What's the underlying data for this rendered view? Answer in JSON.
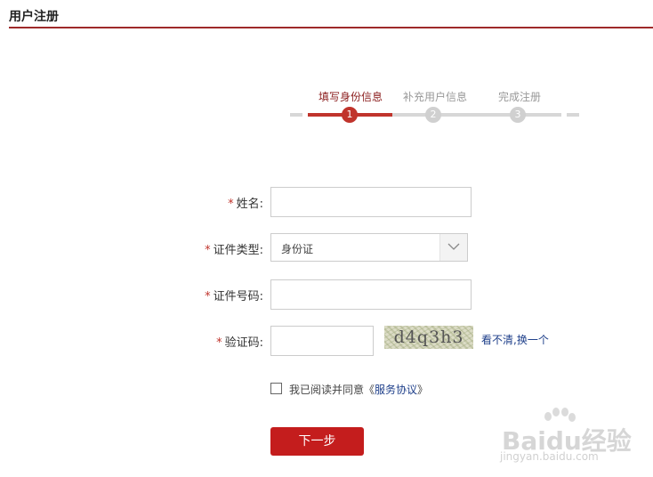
{
  "header": {
    "title": "用户注册"
  },
  "steps": [
    {
      "label": "填写身份信息",
      "number": "1",
      "active": true
    },
    {
      "label": "补充用户信息",
      "number": "2",
      "active": false
    },
    {
      "label": "完成注册",
      "number": "3",
      "active": false
    }
  ],
  "form": {
    "required_mark": "*",
    "name_label": "姓名:",
    "id_type_label": "证件类型:",
    "id_type_value": "身份证",
    "id_number_label": "证件号码:",
    "captcha_label": "验证码:",
    "captcha_text": "d4q3h3",
    "refresh_label": "看不清,换一个"
  },
  "agreement": {
    "text": "我已阅读并同意《",
    "link": "服务协议",
    "suffix": "》"
  },
  "next_button": "下一步",
  "watermark": {
    "logo": "Baidu经验",
    "url": "jingyan.baidu.com"
  },
  "colors": {
    "accent": "#c0342c",
    "button": "#c41d1d",
    "header_rule": "#9e2a2a",
    "link": "#1e3f8a"
  }
}
